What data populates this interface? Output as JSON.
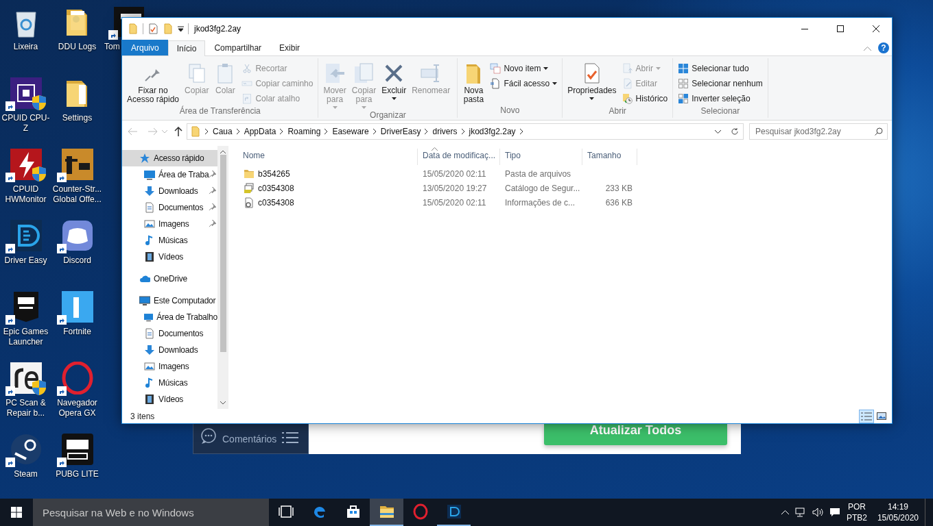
{
  "desktop_icons": [
    {
      "label": "Lixeira",
      "kind": "recycle-bin",
      "shortcut": false,
      "admin_shield": false
    },
    {
      "label": "CPUID CPU-Z",
      "kind": "cpu",
      "shortcut": true,
      "admin_shield": true
    },
    {
      "label": "CPUID HWMonitor",
      "kind": "hwmonitor",
      "shortcut": true,
      "admin_shield": true
    },
    {
      "label": "Driver Easy",
      "kind": "drivereasy",
      "shortcut": true,
      "admin_shield": false
    },
    {
      "label": "Epic Games Launcher",
      "kind": "epic",
      "shortcut": true,
      "admin_shield": false
    },
    {
      "label": "PC Scan & Repair b...",
      "kind": "reimage",
      "shortcut": true,
      "admin_shield": true
    },
    {
      "label": "Steam",
      "kind": "steam",
      "shortcut": true,
      "admin_shield": false
    },
    {
      "label": "DDU Logs",
      "kind": "document-folder",
      "shortcut": false,
      "admin_shield": false
    },
    {
      "label": "Settings",
      "kind": "folder",
      "shortcut": false,
      "admin_shield": false
    },
    {
      "label": "Counter-Str... Global Offe...",
      "kind": "csgo",
      "shortcut": true,
      "admin_shield": false
    },
    {
      "label": "Discord",
      "kind": "discord",
      "shortcut": true,
      "admin_shield": false
    },
    {
      "label": "Fortnite",
      "kind": "fortnite",
      "shortcut": true,
      "admin_shield": false
    },
    {
      "label": "Navegador Opera GX",
      "kind": "opera",
      "shortcut": true,
      "admin_shield": false
    },
    {
      "label": "PUBG LITE",
      "kind": "pubg",
      "shortcut": true,
      "admin_shield": false
    },
    {
      "label": "Tom",
      "kind": "tom",
      "shortcut": true,
      "admin_shield": false
    }
  ],
  "background_app": {
    "comments_label": "Comentários",
    "update_button": "Atualizar Todos"
  },
  "window": {
    "title": "jkod3fg2.2ay",
    "help": "?",
    "tabs": [
      {
        "label": "Arquivo",
        "kind": "file",
        "selected": false
      },
      {
        "label": "Início",
        "kind": "tab",
        "selected": true
      },
      {
        "label": "Compartilhar",
        "kind": "tab",
        "selected": false
      },
      {
        "label": "Exibir",
        "kind": "tab",
        "selected": false
      }
    ],
    "ribbon_groups": [
      {
        "label": "Área de Transferência",
        "items": [
          {
            "label": "Fixar no\nAcesso rápido",
            "kind": "pin",
            "disabled": false,
            "dropdown": false
          },
          {
            "label": "Copiar",
            "kind": "copy",
            "disabled": true,
            "dropdown": false
          },
          {
            "label": "Colar",
            "kind": "paste",
            "disabled": true,
            "dropdown": false
          },
          {
            "label": "Recortar",
            "kind": "cut",
            "disabled": true,
            "dropdown": false
          },
          {
            "label": "Copiar caminho",
            "kind": "copy-path",
            "disabled": true,
            "dropdown": false
          },
          {
            "label": "Colar atalho",
            "kind": "paste-shortcut",
            "disabled": true,
            "dropdown": false
          }
        ]
      },
      {
        "label": "Organizar",
        "items": [
          {
            "label": "Mover\npara",
            "kind": "move",
            "disabled": true,
            "dropdown": true
          },
          {
            "label": "Copiar\npara",
            "kind": "copy-to",
            "disabled": true,
            "dropdown": true
          },
          {
            "label": "Excluir",
            "kind": "delete",
            "disabled": false,
            "dropdown": true
          },
          {
            "label": "Renomear",
            "kind": "rename",
            "disabled": true,
            "dropdown": false
          }
        ]
      },
      {
        "label": "Novo",
        "items": [
          {
            "label": "Nova\npasta",
            "kind": "new-folder",
            "disabled": false,
            "dropdown": false
          },
          {
            "label": "Novo item",
            "kind": "new-item",
            "disabled": false,
            "dropdown": true
          },
          {
            "label": "Fácil acesso",
            "kind": "easy-access",
            "disabled": false,
            "dropdown": true
          }
        ]
      },
      {
        "label": "Abrir",
        "items": [
          {
            "label": "Propriedades",
            "kind": "properties",
            "disabled": false,
            "dropdown": true
          },
          {
            "label": "Abrir",
            "kind": "open",
            "disabled": true,
            "dropdown": true
          },
          {
            "label": "Editar",
            "kind": "edit",
            "disabled": true,
            "dropdown": false
          },
          {
            "label": "Histórico",
            "kind": "history",
            "disabled": false,
            "dropdown": false
          }
        ]
      },
      {
        "label": "Selecionar",
        "items": [
          {
            "label": "Selecionar tudo",
            "kind": "select-all",
            "disabled": false,
            "dropdown": false
          },
          {
            "label": "Selecionar nenhum",
            "kind": "select-none",
            "disabled": false,
            "dropdown": false
          },
          {
            "label": "Inverter seleção",
            "kind": "invert",
            "disabled": false,
            "dropdown": false
          }
        ]
      }
    ],
    "address": [
      "Caua",
      "AppData",
      "Roaming",
      "Easeware",
      "DriverEasy",
      "drivers",
      "jkod3fg2.2ay"
    ],
    "search": {
      "placeholder": "Pesquisar jkod3fg2.2ay"
    },
    "nav_pane": [
      {
        "label": "Acesso rápido",
        "kind": "star",
        "selected": true,
        "pinned": false,
        "children": [
          {
            "label": "Área de Traba",
            "kind": "desktop",
            "selected": false,
            "pinned": true
          },
          {
            "label": "Downloads",
            "kind": "download",
            "selected": false,
            "pinned": true
          },
          {
            "label": "Documentos",
            "kind": "document",
            "selected": false,
            "pinned": true
          },
          {
            "label": "Imagens",
            "kind": "images",
            "selected": false,
            "pinned": true
          },
          {
            "label": "Músicas",
            "kind": "music",
            "selected": false,
            "pinned": false
          },
          {
            "label": "Vídeos",
            "kind": "video",
            "selected": false,
            "pinned": false
          }
        ]
      },
      {
        "label": "OneDrive",
        "kind": "cloud",
        "selected": false,
        "pinned": false
      },
      {
        "label": "Este Computador",
        "kind": "computer",
        "selected": false,
        "pinned": false,
        "children": [
          {
            "label": "Área de Trabalho",
            "kind": "desktop",
            "selected": false,
            "pinned": false
          },
          {
            "label": "Documentos",
            "kind": "document",
            "selected": false,
            "pinned": false
          },
          {
            "label": "Downloads",
            "kind": "download",
            "selected": false,
            "pinned": false
          },
          {
            "label": "Imagens",
            "kind": "images",
            "selected": false,
            "pinned": false
          },
          {
            "label": "Músicas",
            "kind": "music",
            "selected": false,
            "pinned": false
          },
          {
            "label": "Vídeos",
            "kind": "video",
            "selected": false,
            "pinned": false
          }
        ]
      }
    ],
    "columns": [
      "Nome",
      "Data de modificaç...",
      "Tipo",
      "Tamanho"
    ],
    "files": [
      {
        "name": "b354265",
        "modified": "15/05/2020 02:11",
        "type": "Pasta de arquivos",
        "kind": "folder"
      },
      {
        "name": "c0354308",
        "modified": "13/05/2020 19:27",
        "type": "Catálogo de Segur...",
        "size": "233 KB",
        "kind": "catalog"
      },
      {
        "name": "c0354308",
        "modified": "15/05/2020 02:11",
        "type": "Informações de c...",
        "size": "636 KB",
        "kind": "info"
      }
    ],
    "status": "3 itens",
    "views": [
      {
        "kind": "details",
        "selected": true
      },
      {
        "kind": "large-icons",
        "selected": false
      }
    ]
  },
  "taskbar": {
    "search_placeholder": "Pesquisar na Web e no Windows",
    "apps": [
      {
        "kind": "task-view",
        "running": false,
        "selected": false
      },
      {
        "kind": "edge",
        "running": false,
        "selected": false
      },
      {
        "kind": "store",
        "running": false,
        "selected": false
      },
      {
        "kind": "explorer",
        "running": true,
        "selected": true
      },
      {
        "kind": "opera",
        "running": false,
        "selected": false
      },
      {
        "kind": "drivereasy",
        "running": true,
        "selected": false
      }
    ],
    "language": [
      "POR",
      "PTB2"
    ],
    "time": "14:19",
    "date": "15/05/2020"
  }
}
